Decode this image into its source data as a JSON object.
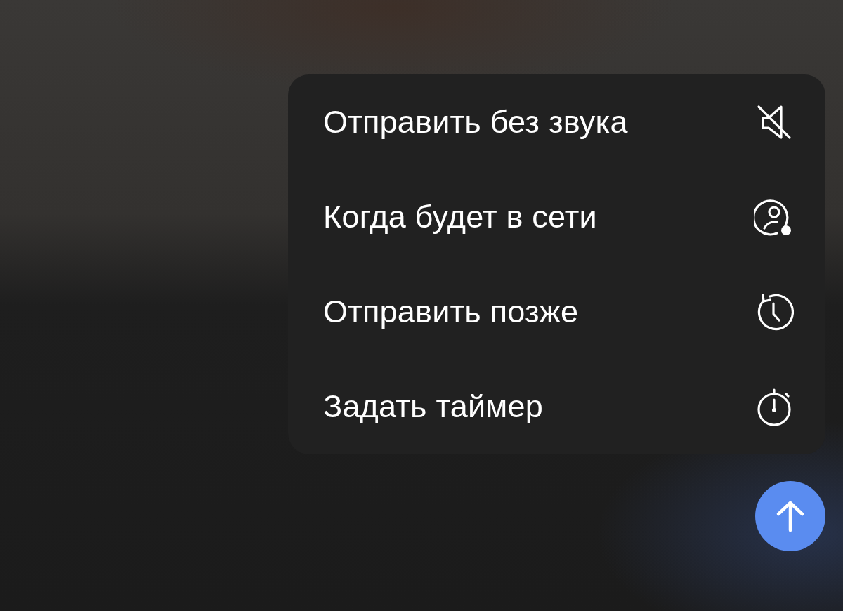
{
  "menu": {
    "items": [
      {
        "label": "Отправить без звука",
        "kind": "silent"
      },
      {
        "label": "Когда будет в сети",
        "kind": "online"
      },
      {
        "label": "Отправить позже",
        "kind": "schedule"
      },
      {
        "label": "Задать таймер",
        "kind": "timer"
      }
    ]
  },
  "send_button": {
    "kind": "arrow"
  }
}
